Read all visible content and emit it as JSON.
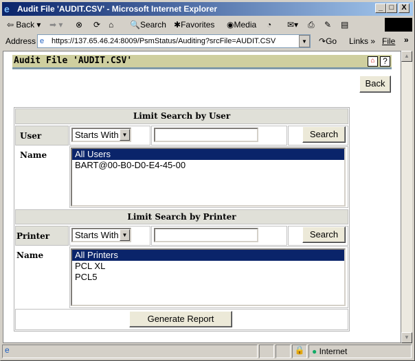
{
  "window": {
    "title": "Audit File 'AUDIT.CSV' - Microsoft Internet Explorer",
    "min": "_",
    "max": "□",
    "close": "X"
  },
  "toolbar": {
    "back": "Back",
    "search": "Search",
    "favorites": "Favorites",
    "media": "Media"
  },
  "address": {
    "label": "Address",
    "url": "https://137.65.46.24:8009/PsmStatus/Auditing?srcFile=AUDIT.CSV",
    "go": "Go",
    "links": "Links",
    "file": "File"
  },
  "page": {
    "header": "Audit File 'AUDIT.CSV'",
    "back": "Back",
    "help": "?",
    "user_section": {
      "title": "Limit Search by User",
      "label": "User Name",
      "mode": "Starts With",
      "value": "",
      "search": "Search",
      "options": [
        "All Users",
        "BART@00-B0-D0-E4-45-00"
      ],
      "selected": 0
    },
    "printer_section": {
      "title": "Limit Search by Printer",
      "label": "Printer Name",
      "mode": "Starts With",
      "value": "",
      "search": "Search",
      "options": [
        "All Printers",
        "PCL XL",
        "PCL5"
      ],
      "selected": 0
    },
    "generate": "Generate Report"
  },
  "status": {
    "zone": "Internet"
  }
}
